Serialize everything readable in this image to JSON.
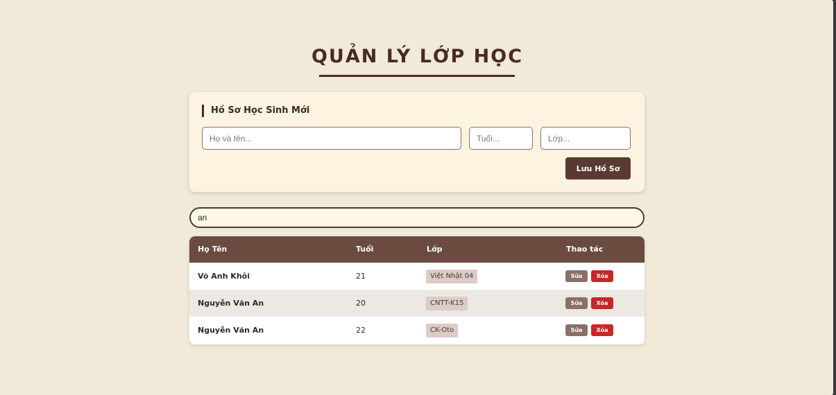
{
  "title": "QUẢN LÝ LỚP HỌC",
  "form": {
    "heading": "Hồ Sơ Học Sinh Mới",
    "name_placeholder": "Họ và tên...",
    "age_placeholder": "Tuổi...",
    "class_placeholder": "Lớp...",
    "save_label": "Lưu Hồ Sơ"
  },
  "search": {
    "value": "an"
  },
  "table": {
    "headers": {
      "name": "Họ Tên",
      "age": "Tuổi",
      "class": "Lớp",
      "actions": "Thao tác"
    },
    "edit_label": "Sửa",
    "delete_label": "Xóa",
    "rows": [
      {
        "name": "Võ Anh Khôi",
        "age": "21",
        "class": "Việt Nhật 04"
      },
      {
        "name": "Nguyễn Văn An",
        "age": "20",
        "class": "CNTT-K15"
      },
      {
        "name": "Nguyễn Văn An",
        "age": "22",
        "class": "CK-Oto"
      }
    ]
  },
  "colors": {
    "background": "#f1ead8",
    "primary": "#5a3a30",
    "table_header": "#6b4a3f",
    "delete": "#c62828"
  }
}
